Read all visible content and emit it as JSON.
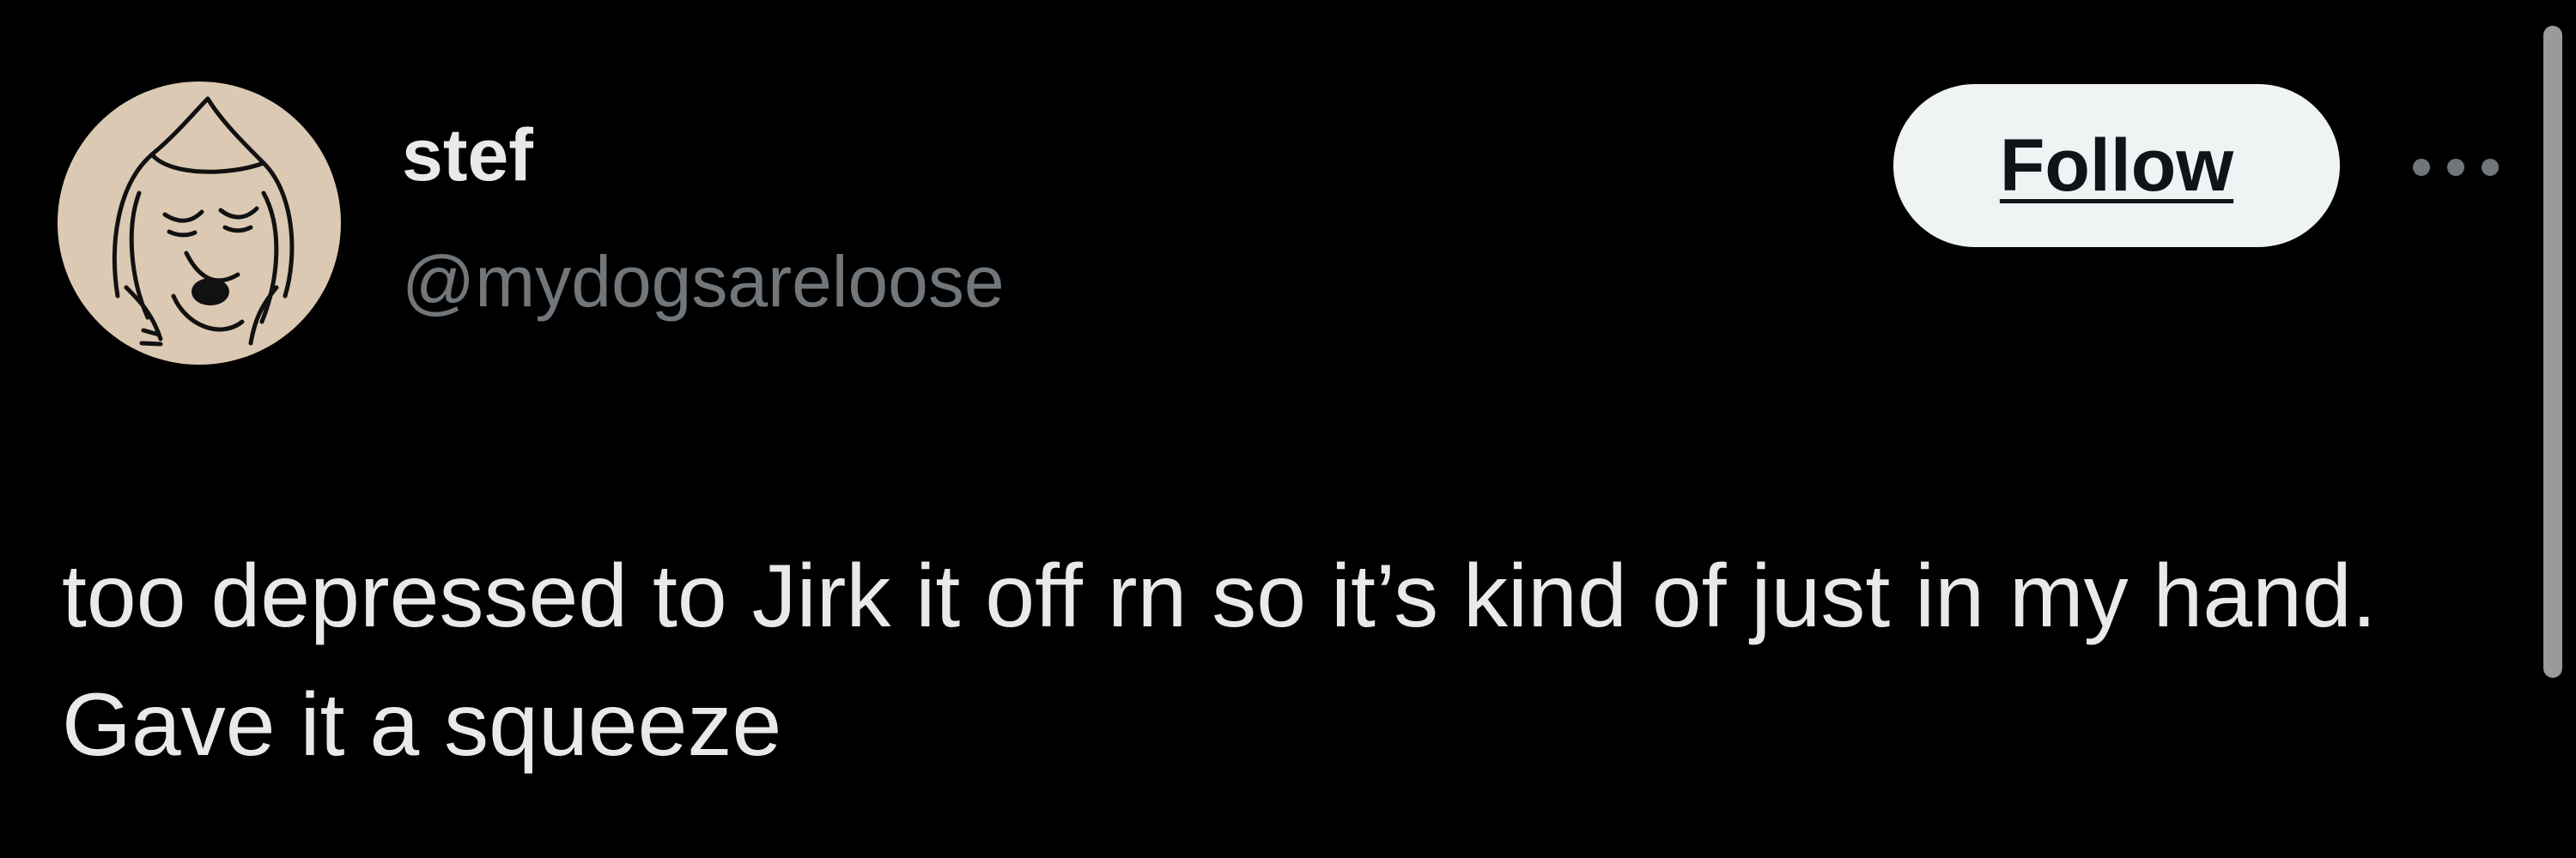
{
  "user": {
    "display_name": "stef",
    "handle": "@mydogsareloose",
    "avatar_icon": "dog-sketch-avatar"
  },
  "actions": {
    "follow_label": "Follow",
    "more_icon": "more-options-icon"
  },
  "tweet": {
    "text": "too depressed to Jirk it off rn so it’s kind of just in my hand. Gave it a squeeze"
  },
  "colors": {
    "background": "#000000",
    "primary_text": "#e7e9ea",
    "secondary_text": "#71767b",
    "follow_button_bg": "#eff3f4",
    "avatar_bg": "#dbc9b3"
  }
}
